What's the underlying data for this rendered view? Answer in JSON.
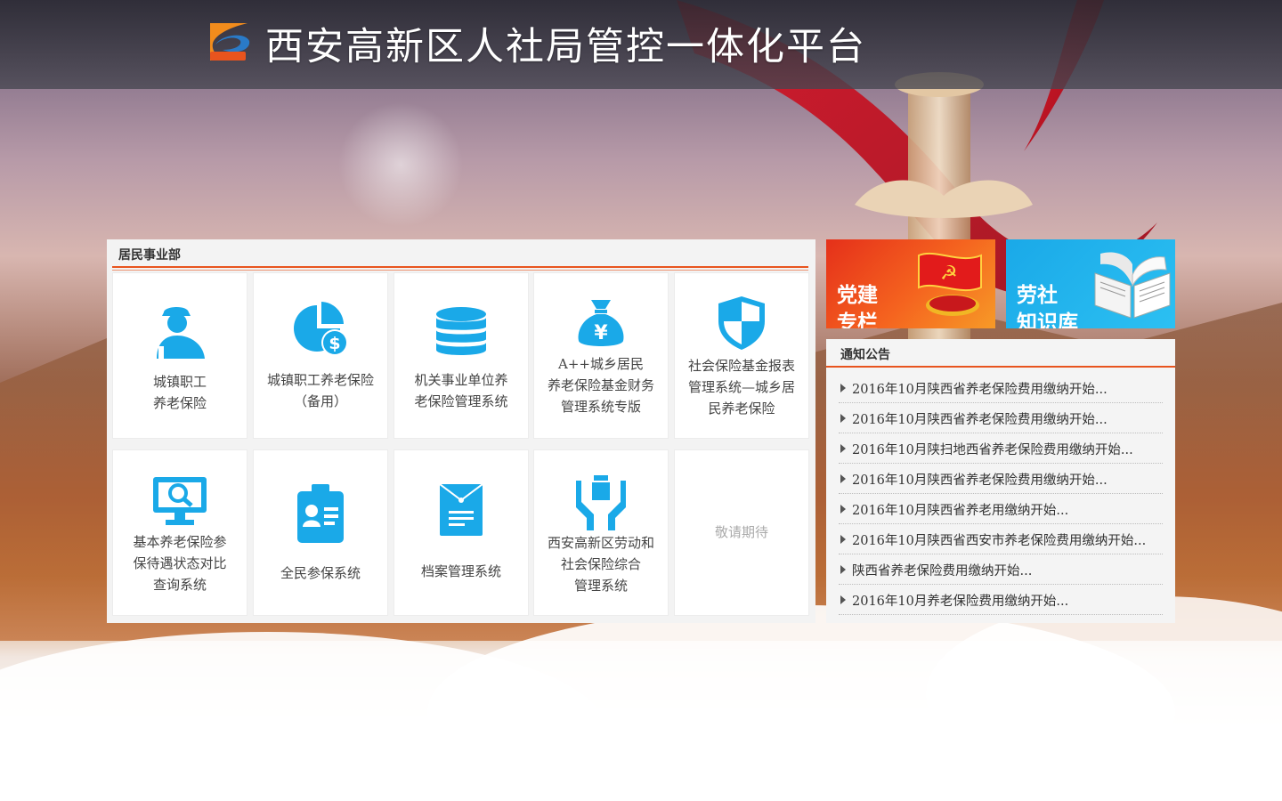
{
  "header": {
    "title": "西安高新区人社局管控一体化平台",
    "logo_icon": "swoosh-logo-icon"
  },
  "main": {
    "section_title": "居民事业部",
    "tiles": [
      {
        "icon": "worker-person-icon",
        "lines": [
          "城镇职工",
          "养老保险"
        ]
      },
      {
        "icon": "pie-chart-dollar-icon",
        "lines": [
          "城镇职工养老保险",
          "（备用）"
        ]
      },
      {
        "icon": "database-icon",
        "lines": [
          "机关事业单位养",
          "老保险管理系统"
        ]
      },
      {
        "icon": "money-bag-yen-icon",
        "lines": [
          "A++城乡居民",
          "养老保险基金财务",
          "管理系统专版"
        ]
      },
      {
        "icon": "shield-icon",
        "lines": [
          "社会保险基金报表",
          "管理系统—城乡居",
          "民养老保险"
        ]
      },
      {
        "icon": "monitor-search-icon",
        "lines": [
          "基本养老保险参",
          "保待遇状态对比",
          "查询系统"
        ]
      },
      {
        "icon": "id-card-icon",
        "lines": [
          "全民参保系统"
        ]
      },
      {
        "icon": "archive-folder-icon",
        "lines": [
          "档案管理系统"
        ]
      },
      {
        "icon": "hands-gift-icon",
        "lines": [
          "西安高新区劳动和",
          "社会保险综合",
          "管理系统"
        ]
      },
      {
        "icon": "",
        "lines": [
          "敬请期待"
        ]
      }
    ]
  },
  "sidebar": {
    "promo_party": {
      "line1": "党建",
      "line2": "专栏",
      "icon": "party-badge-icon"
    },
    "promo_knowledge": {
      "line1": "劳社",
      "line2": "知识库",
      "icon": "open-book-icon"
    },
    "notice_title": "通知公告",
    "notices": [
      "2016年10月陕西省养老保险费用缴纳开始...",
      "2016年10月陕西省养老保险费用缴纳开始...",
      "2016年10月陕扫地西省养老保险费用缴纳开始...",
      "2016年10月陕西省养老保险费用缴纳开始...",
      "2016年10月陕西省养老用缴纳开始...",
      "2016年10月陕西省西安市养老保险费用缴纳开始...",
      "陕西省养老保险费用缴纳开始...",
      "2016年10月养老保险费用缴纳开始..."
    ]
  },
  "colors": {
    "accent": "#e8541e",
    "icon_blue": "#1aa9e8",
    "party_red": "#e5301a",
    "knowledge_blue": "#1aa9e8"
  }
}
